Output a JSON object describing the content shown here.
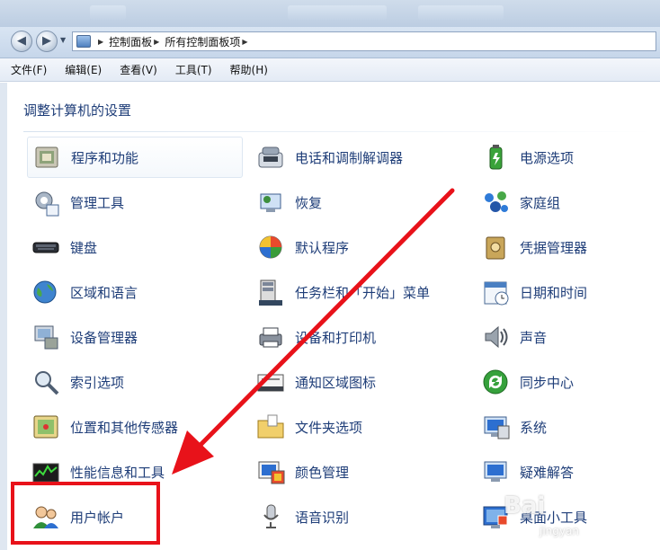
{
  "address": {
    "crumbs": [
      "控制面板",
      "所有控制面板项"
    ]
  },
  "menu": [
    "文件(F)",
    "编辑(E)",
    "查看(V)",
    "工具(T)",
    "帮助(H)"
  ],
  "page": {
    "title": "调整计算机的设置"
  },
  "items": [
    {
      "label": "程序和功能",
      "icon": "programs-features-icon"
    },
    {
      "label": "电话和调制解调器",
      "icon": "phone-modem-icon"
    },
    {
      "label": "电源选项",
      "icon": "power-options-icon"
    },
    {
      "label": "管理工具",
      "icon": "admin-tools-icon"
    },
    {
      "label": "恢复",
      "icon": "recovery-icon"
    },
    {
      "label": "家庭组",
      "icon": "homegroup-icon"
    },
    {
      "label": "键盘",
      "icon": "keyboard-icon"
    },
    {
      "label": "默认程序",
      "icon": "default-programs-icon"
    },
    {
      "label": "凭据管理器",
      "icon": "credential-manager-icon"
    },
    {
      "label": "区域和语言",
      "icon": "region-language-icon"
    },
    {
      "label": "任务栏和「开始」菜单",
      "icon": "taskbar-start-icon"
    },
    {
      "label": "日期和时间",
      "icon": "date-time-icon"
    },
    {
      "label": "设备管理器",
      "icon": "device-manager-icon"
    },
    {
      "label": "设备和打印机",
      "icon": "devices-printers-icon"
    },
    {
      "label": "声音",
      "icon": "sound-icon"
    },
    {
      "label": "索引选项",
      "icon": "indexing-options-icon"
    },
    {
      "label": "通知区域图标",
      "icon": "notification-area-icon"
    },
    {
      "label": "同步中心",
      "icon": "sync-center-icon"
    },
    {
      "label": "位置和其他传感器",
      "icon": "location-sensors-icon"
    },
    {
      "label": "文件夹选项",
      "icon": "folder-options-icon"
    },
    {
      "label": "系统",
      "icon": "system-icon"
    },
    {
      "label": "性能信息和工具",
      "icon": "performance-icon"
    },
    {
      "label": "颜色管理",
      "icon": "color-management-icon"
    },
    {
      "label": "疑难解答",
      "icon": "troubleshooting-icon"
    },
    {
      "label": "用户帐户",
      "icon": "user-accounts-icon"
    },
    {
      "label": "语音识别",
      "icon": "speech-recognition-icon"
    },
    {
      "label": "桌面小工具",
      "icon": "desktop-gadgets-icon"
    }
  ],
  "colors": {
    "link": "#1e3d78",
    "annotation": "#e8121a"
  },
  "watermark": {
    "brand": "Bai",
    "sub": "jingyan"
  }
}
